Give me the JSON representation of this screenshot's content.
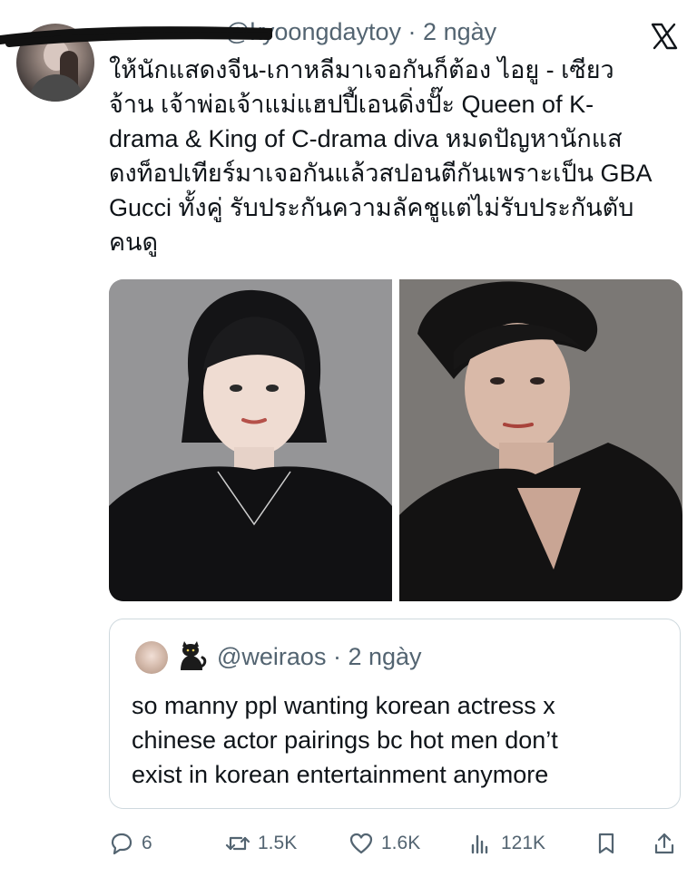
{
  "tweet": {
    "handle": "@kyoongdaytoy",
    "time": "2 ngày",
    "text_lines": [
      "ให้นักแสดงจีน-เกาหลีมาเจอกันก็ต้อง ไอยู - เซียว",
      "จ้าน เจ้าพ่อเจ้าแม่แฮปปี้เอนดิ่งปั๊ะ Queen of K-",
      "drama & King of C-drama diva หมดปัญหานักแส",
      "ดงท็อปเทียร์มาเจอกันแล้วสปอนตีกันเพราะเป็น GBA",
      "Gucci ทั้งคู่ รับประกันความลัคชูแต่ไม่รับประกันตับ",
      "คนดู"
    ]
  },
  "quote": {
    "handle": "@weiraos",
    "time": "2 ngày",
    "text_lines": [
      "so manny ppl wanting korean actress x",
      "chinese actor pairings bc hot men don’t",
      "exist in korean entertainment anymore"
    ]
  },
  "actions": {
    "replies": "6",
    "reposts": "1.5K",
    "likes": "1.6K",
    "views": "121K"
  },
  "icons": {
    "brand": "x-logo-icon",
    "reply": "reply-icon",
    "repost": "repost-icon",
    "like": "heart-icon",
    "views": "views-icon",
    "bookmark": "bookmark-icon",
    "share": "share-icon"
  }
}
